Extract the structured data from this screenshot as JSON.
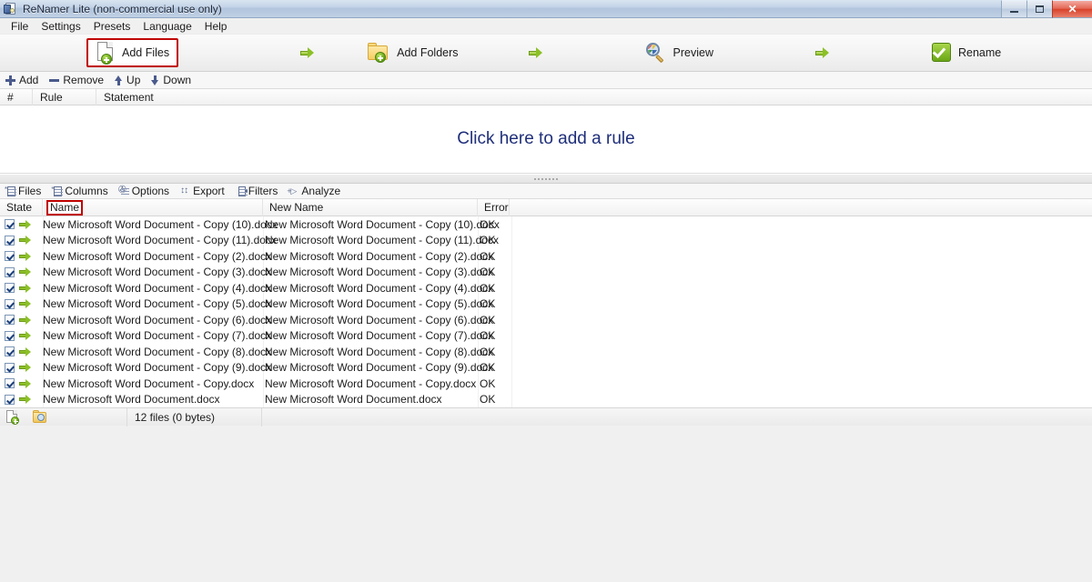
{
  "window": {
    "title": "ReNamer Lite (non-commercial use only)",
    "icon": "renamer-app-icon",
    "buttons": {
      "minimize": "minimize",
      "maximize": "maximize",
      "close": "✕"
    }
  },
  "menu": {
    "items": [
      {
        "label": "File",
        "mnemonic": "F"
      },
      {
        "label": "Settings",
        "mnemonic": "S"
      },
      {
        "label": "Presets",
        "mnemonic": "P"
      },
      {
        "label": "Language",
        "mnemonic": "L"
      },
      {
        "label": "Help",
        "mnemonic": "H"
      }
    ]
  },
  "toolbar": {
    "items": [
      {
        "label": "Add Files",
        "icon": "add-files-icon",
        "highlighted": true
      },
      {
        "label": "Add Folders",
        "icon": "add-folders-icon",
        "highlighted": false
      },
      {
        "label": "Preview",
        "icon": "preview-icon",
        "highlighted": false
      },
      {
        "label": "Rename",
        "icon": "rename-icon",
        "highlighted": false
      }
    ],
    "separator_icon": "green-arrow-icon",
    "highlight_color": "#c00000"
  },
  "rules_toolbar": {
    "items": [
      {
        "label": "Add",
        "icon": "plus-icon"
      },
      {
        "label": "Remove",
        "icon": "minus-icon"
      },
      {
        "label": "Up",
        "icon": "arrow-up-icon"
      },
      {
        "label": "Down",
        "icon": "arrow-down-icon"
      }
    ]
  },
  "rules_grid": {
    "columns": [
      "#",
      "Rule",
      "Statement"
    ],
    "empty_message": "Click here to add a rule",
    "empty_message_color": "#1f2f7a",
    "rows": []
  },
  "file_tabs": {
    "items": [
      {
        "label": "Files",
        "icon": "files-tab-icon",
        "active": true
      },
      {
        "label": "Columns",
        "icon": "columns-tab-icon",
        "active": false
      },
      {
        "label": "Options",
        "icon": "options-tab-icon",
        "active": false
      },
      {
        "label": "Export",
        "icon": "export-tab-icon",
        "active": false
      },
      {
        "label": "Filters",
        "icon": "filters-tab-icon",
        "active": false
      },
      {
        "label": "Analyze",
        "icon": "analyze-tab-icon",
        "active": false
      }
    ]
  },
  "file_list": {
    "columns": [
      {
        "key": "state",
        "label": "State",
        "highlighted": false
      },
      {
        "key": "name",
        "label": "Name",
        "highlighted": true
      },
      {
        "key": "new_name",
        "label": "New Name",
        "highlighted": false
      },
      {
        "key": "error",
        "label": "Error",
        "highlighted": false
      }
    ],
    "highlight_color": "#c00000",
    "rows": [
      {
        "checked": true,
        "name": "New Microsoft Word Document - Copy (10).docx",
        "new_name": "New Microsoft Word Document - Copy (10).docx",
        "error": "OK"
      },
      {
        "checked": true,
        "name": "New Microsoft Word Document - Copy (11).docx",
        "new_name": "New Microsoft Word Document - Copy (11).docx",
        "error": "OK"
      },
      {
        "checked": true,
        "name": "New Microsoft Word Document - Copy (2).docx",
        "new_name": "New Microsoft Word Document - Copy (2).docx",
        "error": "OK"
      },
      {
        "checked": true,
        "name": "New Microsoft Word Document - Copy (3).docx",
        "new_name": "New Microsoft Word Document - Copy (3).docx",
        "error": "OK"
      },
      {
        "checked": true,
        "name": "New Microsoft Word Document - Copy (4).docx",
        "new_name": "New Microsoft Word Document - Copy (4).docx",
        "error": "OK"
      },
      {
        "checked": true,
        "name": "New Microsoft Word Document - Copy (5).docx",
        "new_name": "New Microsoft Word Document - Copy (5).docx",
        "error": "OK"
      },
      {
        "checked": true,
        "name": "New Microsoft Word Document - Copy (6).docx",
        "new_name": "New Microsoft Word Document - Copy (6).docx",
        "error": "OK"
      },
      {
        "checked": true,
        "name": "New Microsoft Word Document - Copy (7).docx",
        "new_name": "New Microsoft Word Document - Copy (7).docx",
        "error": "OK"
      },
      {
        "checked": true,
        "name": "New Microsoft Word Document - Copy (8).docx",
        "new_name": "New Microsoft Word Document - Copy (8).docx",
        "error": "OK"
      },
      {
        "checked": true,
        "name": "New Microsoft Word Document - Copy (9).docx",
        "new_name": "New Microsoft Word Document - Copy (9).docx",
        "error": "OK"
      },
      {
        "checked": true,
        "name": "New Microsoft Word Document - Copy.docx",
        "new_name": "New Microsoft Word Document - Copy.docx",
        "error": "OK"
      },
      {
        "checked": true,
        "name": "New Microsoft Word Document.docx",
        "new_name": "New Microsoft Word Document.docx",
        "error": "OK"
      }
    ]
  },
  "status_bar": {
    "icons": [
      "add-files-status-icon",
      "browse-folder-status-icon"
    ],
    "count_text": "12 files (0 bytes)"
  }
}
